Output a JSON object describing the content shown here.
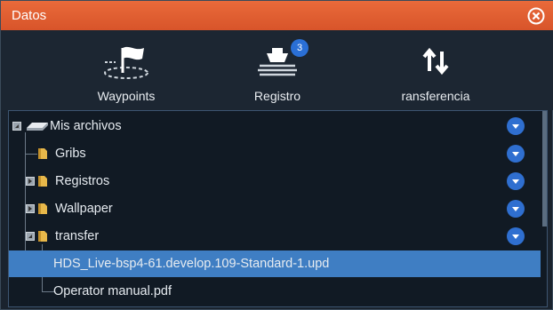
{
  "window": {
    "title": "Datos"
  },
  "toolbar": {
    "waypoints_label": "Waypoints",
    "registro_label": "Registro",
    "registro_badge": "3",
    "transfer_label": "ransferencia"
  },
  "tree": {
    "root": "Mis archivos",
    "items": [
      {
        "label": "Gribs"
      },
      {
        "label": "Registros"
      },
      {
        "label": "Wallpaper"
      },
      {
        "label": "transfer"
      },
      {
        "label": "HDS_Live-bsp4-61.develop.109-Standard-1.upd"
      },
      {
        "label": "Operator manual.pdf"
      }
    ]
  },
  "colors": {
    "title_bar": "#e05f30",
    "selection": "#3f7ec3",
    "accent_button": "#2f6fd0"
  }
}
